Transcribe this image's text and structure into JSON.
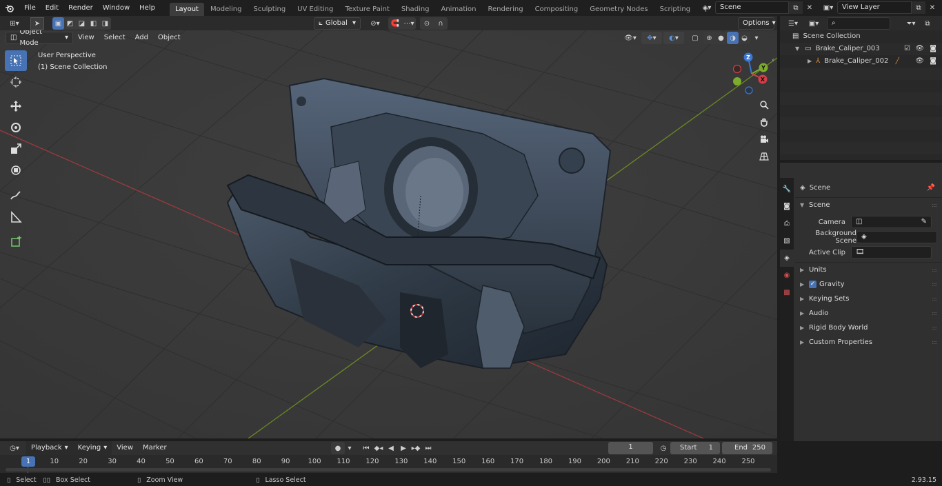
{
  "topbar": {
    "menus": [
      "File",
      "Edit",
      "Render",
      "Window",
      "Help"
    ],
    "workspaces": [
      "Layout",
      "Modeling",
      "Sculpting",
      "UV Editing",
      "Texture Paint",
      "Shading",
      "Animation",
      "Rendering",
      "Compositing",
      "Geometry Nodes",
      "Scripting"
    ],
    "active_workspace": "Layout",
    "scene": "Scene",
    "view_layer": "View Layer"
  },
  "viewport": {
    "mode": "Object Mode",
    "menus": [
      "View",
      "Select",
      "Add",
      "Object"
    ],
    "orientation": "Global",
    "options": "Options",
    "perspective_label": "User Perspective",
    "collection_label": "(1) Scene Collection",
    "gizmo_axes": {
      "x": "X",
      "y": "Y",
      "z": "Z"
    },
    "colors": {
      "x_axis": "#a8373e",
      "y_axis": "#6a8e23",
      "z_axis": "#2f6ab8",
      "background": "#393939"
    }
  },
  "tools": [
    "select-box",
    "cursor",
    "move",
    "rotate",
    "scale",
    "transform",
    "annotate",
    "measure",
    "add-cube"
  ],
  "outliner": {
    "root": "Scene Collection",
    "items": [
      {
        "name": "Brake_Caliper_003",
        "level": 1
      },
      {
        "name": "Brake_Caliper_002",
        "level": 2
      }
    ]
  },
  "properties": {
    "context": "Scene",
    "panel": "Scene",
    "fields": {
      "camera": "Camera",
      "background_scene": "Background Scene",
      "active_clip": "Active Clip"
    },
    "sections": [
      "Units",
      "Gravity",
      "Keying Sets",
      "Audio",
      "Rigid Body World",
      "Custom Properties"
    ]
  },
  "timeline": {
    "menus": [
      "Playback",
      "Keying",
      "View",
      "Marker"
    ],
    "current_frame": "1",
    "start_label": "Start",
    "start": "1",
    "end_label": "End",
    "end": "250",
    "ruler": [
      "1",
      "10",
      "20",
      "30",
      "40",
      "50",
      "60",
      "70",
      "80",
      "90",
      "100",
      "110",
      "120",
      "130",
      "140",
      "150",
      "160",
      "170",
      "180",
      "190",
      "200",
      "210",
      "220",
      "230",
      "240",
      "250"
    ]
  },
  "status": {
    "select": "Select",
    "box_select": "Box Select",
    "zoom_view": "Zoom View",
    "lasso_select": "Lasso Select",
    "version": "2.93.15"
  }
}
